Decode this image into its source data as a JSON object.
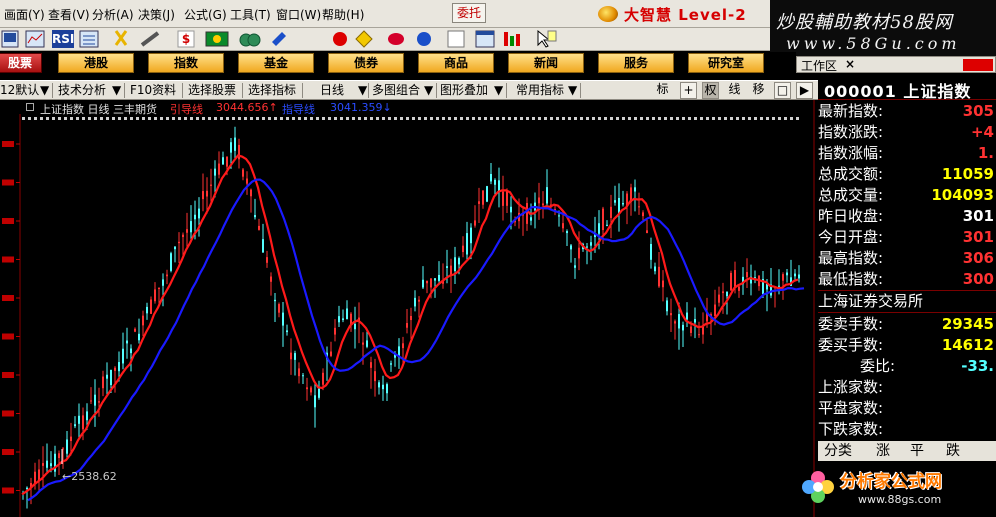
{
  "menu": {
    "items": [
      "画面(Y)",
      "查看(V)",
      "分析(A)",
      "决策(J)",
      "公式(G)",
      "工具(T)",
      "窗口(W)",
      "帮助(H)"
    ],
    "trade_label": "委托",
    "brand_text": "大智慧 Level-2"
  },
  "toolbar": {
    "rsi_label": "RSI",
    "s_label": "$"
  },
  "ad_banner": {
    "title": "炒股輔助教材58股网",
    "url": "www.58Gu.com"
  },
  "market_tabs": [
    "股票",
    "港股",
    "指数",
    "基金",
    "债券",
    "商品",
    "新闻",
    "服务",
    "研究室"
  ],
  "chart_toolbar": {
    "items": [
      "12默认",
      "技术分析",
      "F10资料",
      "选择股票",
      "选择指标",
      "日线",
      "多图组合",
      "图形叠加",
      "常用指标"
    ],
    "buttons": [
      "标",
      "+",
      "权",
      "线",
      "移",
      "□",
      "▶"
    ]
  },
  "chart_info": {
    "title": "上证指数 日线  三丰期货",
    "indicator": "引导线",
    "value1": "3044.656↑",
    "label2": "指导线",
    "value2": "3041.359↓"
  },
  "workarea": {
    "label": "工作区",
    "close": "×"
  },
  "panel": {
    "stock_title": "000001 上证指数",
    "rows": [
      {
        "label": "最新指数:",
        "value": "305"
      },
      {
        "label": "指数涨跌:",
        "value": "+4"
      },
      {
        "label": "指数涨幅:",
        "value": "1."
      },
      {
        "label": "总成交额:",
        "value": "11059"
      },
      {
        "label": "总成交量:",
        "value": "104093"
      },
      {
        "label": "昨日收盘:",
        "value": "301"
      },
      {
        "label": "今日开盘:",
        "value": "301"
      },
      {
        "label": "最高指数:",
        "value": "306"
      },
      {
        "label": "最低指数:",
        "value": "300"
      }
    ],
    "exchange": "上海证券交易所",
    "rows2": [
      {
        "label": "委卖手数:",
        "value": "29345"
      },
      {
        "label": "委买手数:",
        "value": "14612"
      },
      {
        "label": "委比:",
        "value": "-33."
      },
      {
        "label": "上涨家数:",
        "value": ""
      },
      {
        "label": "平盘家数:",
        "value": ""
      },
      {
        "label": "下跌家数:",
        "value": ""
      }
    ],
    "tabs": [
      "分类",
      "涨",
      "平",
      "跌"
    ]
  },
  "colors": {
    "up": "#ff3232",
    "down": "#54ffff",
    "red_line": "#ff1a1a",
    "blue_line": "#1a1aff",
    "yellow_value": "#ffff00"
  },
  "chart_data": {
    "type": "candlestick",
    "low_marker": "←2538.62",
    "series": [
      {
        "name": "引导线",
        "color": "#ff1a1a"
      },
      {
        "name": "指导线",
        "color": "#1a1aff"
      }
    ]
  },
  "watermark": {
    "text": "分析家公式网",
    "url": "www.88gs.com"
  }
}
